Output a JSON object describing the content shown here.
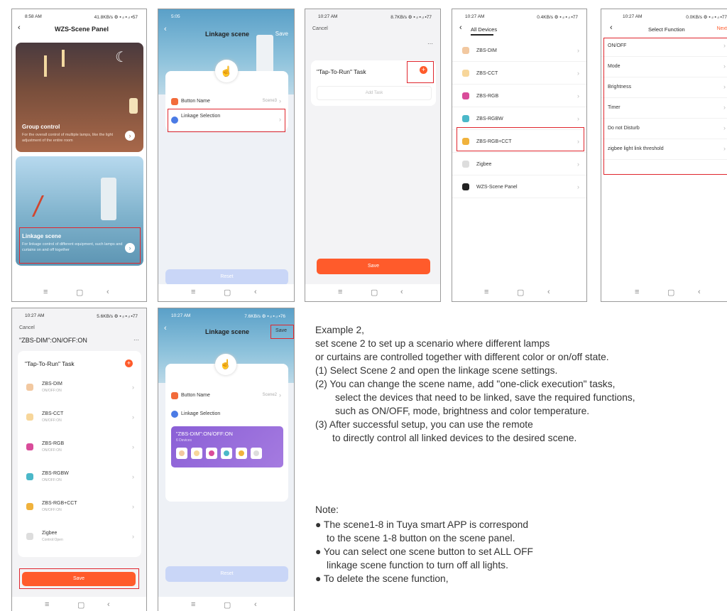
{
  "p1": {
    "time": "8:58 AM",
    "status": "41.8KB/s ⚙ ▪ ᵢₗ ▪ ᵢₗ ▪57",
    "title": "WZS-Scene Panel",
    "card1": {
      "title": "Group control",
      "desc": "For the overall control of multiple lamps, like the light adjustment of the entire room"
    },
    "card2": {
      "title": "Linkage scene",
      "desc": "For linkage control of different equipment, such lamps and curtains on and off together"
    }
  },
  "p2": {
    "time": "5:05",
    "title": "Linkage scene",
    "save": "Save",
    "btn_name": "Button Name",
    "btn_value": "Scene3",
    "linkage": "Linkage Selection",
    "reset": "Reset"
  },
  "p3": {
    "time": "10:27 AM",
    "status": "8.7KB/s ⚙ ▪ ᵢₗ ▪ ᵢₗ ▪77",
    "cancel": "Cancel",
    "task": "\"Tap-To-Run\" Task",
    "add": "Add Task",
    "save": "Save"
  },
  "p4": {
    "time": "10:27 AM",
    "status": "0.4KB/s ⚙ ▪ ᵢₗ ▪ ᵢₗ ▪77",
    "title": "All Devices",
    "devices": [
      "ZBS-DIM",
      "ZBS-CCT",
      "ZBS-RGB",
      "ZBS-RGBW",
      "ZBS-RGB+CCT",
      "Zigbee",
      "WZS-Scene Panel"
    ]
  },
  "p5": {
    "time": "10:27 AM",
    "status": "0.0KB/s ⚙ ▪ ᵢₗ ▪ ᵢₗ ▪77",
    "title": "Select Function",
    "next": "Next",
    "functions": [
      "ON/OFF",
      "Mode",
      "Brightness",
      "Timer",
      "Do not Disturb",
      "zigbee light link threshold"
    ]
  },
  "p6": {
    "time": "10:27 AM",
    "status": "5.6KB/s ⚙ ▪ ᵢₗ ▪ ᵢₗ ▪77",
    "cancel": "Cancel",
    "scene": "\"ZBS-DIM\":ON/OFF:ON",
    "task": "\"Tap-To-Run\" Task",
    "items": [
      {
        "name": "ZBS-DIM",
        "sub": "ON/OFF:ON"
      },
      {
        "name": "ZBS-CCT",
        "sub": "ON/OFF:ON"
      },
      {
        "name": "ZBS-RGB",
        "sub": "ON/OFF:ON"
      },
      {
        "name": "ZBS-RGBW",
        "sub": "ON/OFF:ON"
      },
      {
        "name": "ZBS-RGB+CCT",
        "sub": "ON/OFF:ON"
      },
      {
        "name": "Zigbee",
        "sub": "Control:Open"
      }
    ],
    "save": "Save"
  },
  "p7": {
    "time": "10:27 AM",
    "status": "7.6KB/s ⚙ ▪ ᵢₗ ▪ ᵢₗ ▪76",
    "title": "Linkage scene",
    "save": "Save",
    "btn_name": "Button Name",
    "btn_value": "Scene2",
    "linkage": "Linkage Selection",
    "scene": "\"ZBS-DIM\":ON/OFF:ON",
    "devices": "6 Devices",
    "reset": "Reset"
  },
  "text": {
    "lines": [
      "Example 2,",
      "set scene 2 to set up a scenario where different lamps",
      "or curtains are controlled together with different color or on/off state.",
      "(1) Select Scene 2 and open the linkage scene settings.",
      "(2) You can change the scene name, add \"one-click execution\" tasks,",
      "select the devices that need to be linked, save the required functions,",
      "such as ON/OFF, mode, brightness and color temperature.",
      "(3) After successful setup, you can use the remote",
      "to directly control all linked devices to the desired scene."
    ],
    "note": "Note:",
    "bullets": [
      "● The scene1-8 in Tuya smart APP is correspond",
      "to the scene 1-8 button on the scene panel.",
      "● You can select one scene button to set ALL OFF",
      "linkage scene function to turn off all lights.",
      "● To delete the scene function,"
    ]
  },
  "device_colors": [
    "#f2c8a0",
    "#f7d69a",
    "#d94c9a",
    "#4bb8c9",
    "#f0b23c",
    "#dddddd",
    "#222222"
  ]
}
